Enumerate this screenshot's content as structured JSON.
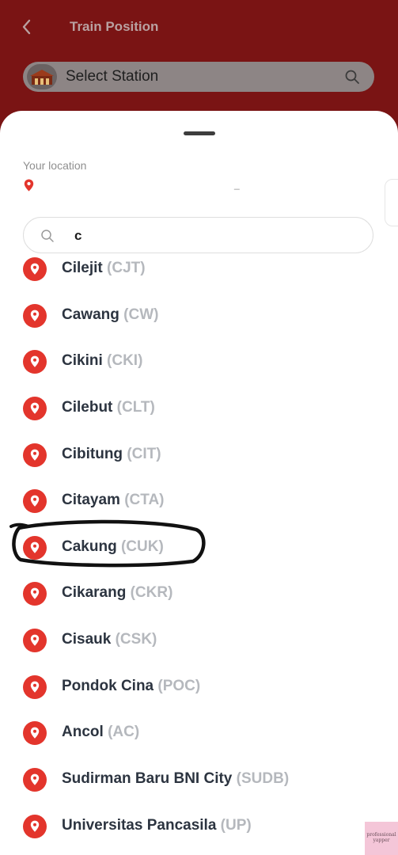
{
  "header": {
    "title": "Train Position",
    "back_icon": "chevron-left-icon"
  },
  "station_bar": {
    "label": "Select Station",
    "search_icon": "search-icon"
  },
  "sheet": {
    "location_label": "Your location",
    "location_value": "_",
    "search": {
      "value": "c"
    },
    "stations": [
      {
        "name": "Cilejit",
        "code": "(CJT)"
      },
      {
        "name": "Cawang",
        "code": "(CW)"
      },
      {
        "name": "Cikini",
        "code": "(CKI)"
      },
      {
        "name": "Cilebut",
        "code": "(CLT)"
      },
      {
        "name": "Cibitung",
        "code": "(CIT)"
      },
      {
        "name": "Citayam",
        "code": "(CTA)"
      },
      {
        "name": "Cakung",
        "code": "(CUK)"
      },
      {
        "name": "Cikarang",
        "code": "(CKR)"
      },
      {
        "name": "Cisauk",
        "code": "(CSK)"
      },
      {
        "name": "Pondok Cina",
        "code": "(POC)"
      },
      {
        "name": "Ancol",
        "code": "(AC)"
      },
      {
        "name": "Sudirman Baru BNI City",
        "code": "(SUDB)"
      },
      {
        "name": "Universitas Pancasila",
        "code": "(UP)"
      }
    ]
  },
  "watermark": {
    "text": "professional yapper"
  },
  "colors": {
    "header_bg": "#7a1414",
    "pin_red": "#e3352c",
    "name_text": "#2c3440",
    "code_text": "#b5b8bd"
  }
}
